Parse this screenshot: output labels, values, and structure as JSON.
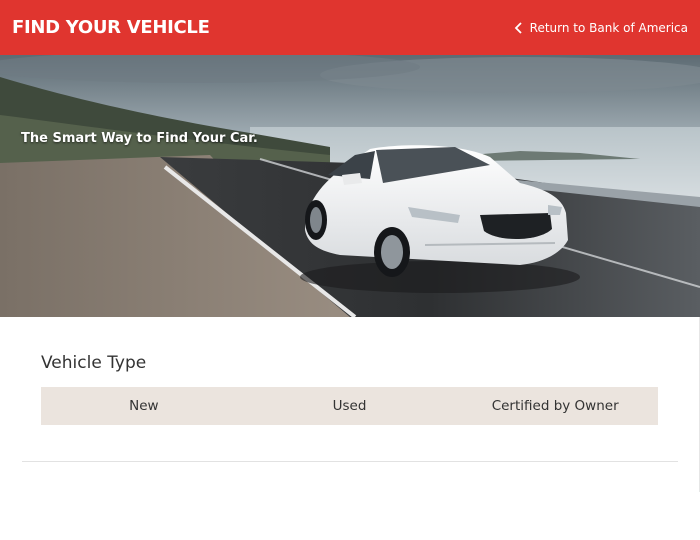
{
  "header": {
    "title": "FIND YOUR VEHICLE",
    "return_label": "Return to Bank of America",
    "background_color": "#e0352f"
  },
  "hero": {
    "tagline": "The Smart Way to Find Your Car.",
    "image_subject": "white sedan driving on coastal road"
  },
  "vehicle_type": {
    "title": "Vehicle Type",
    "options": [
      {
        "label": "New"
      },
      {
        "label": "Used"
      },
      {
        "label": "Certified by Owner"
      }
    ],
    "bar_color": "#ebe4de"
  }
}
